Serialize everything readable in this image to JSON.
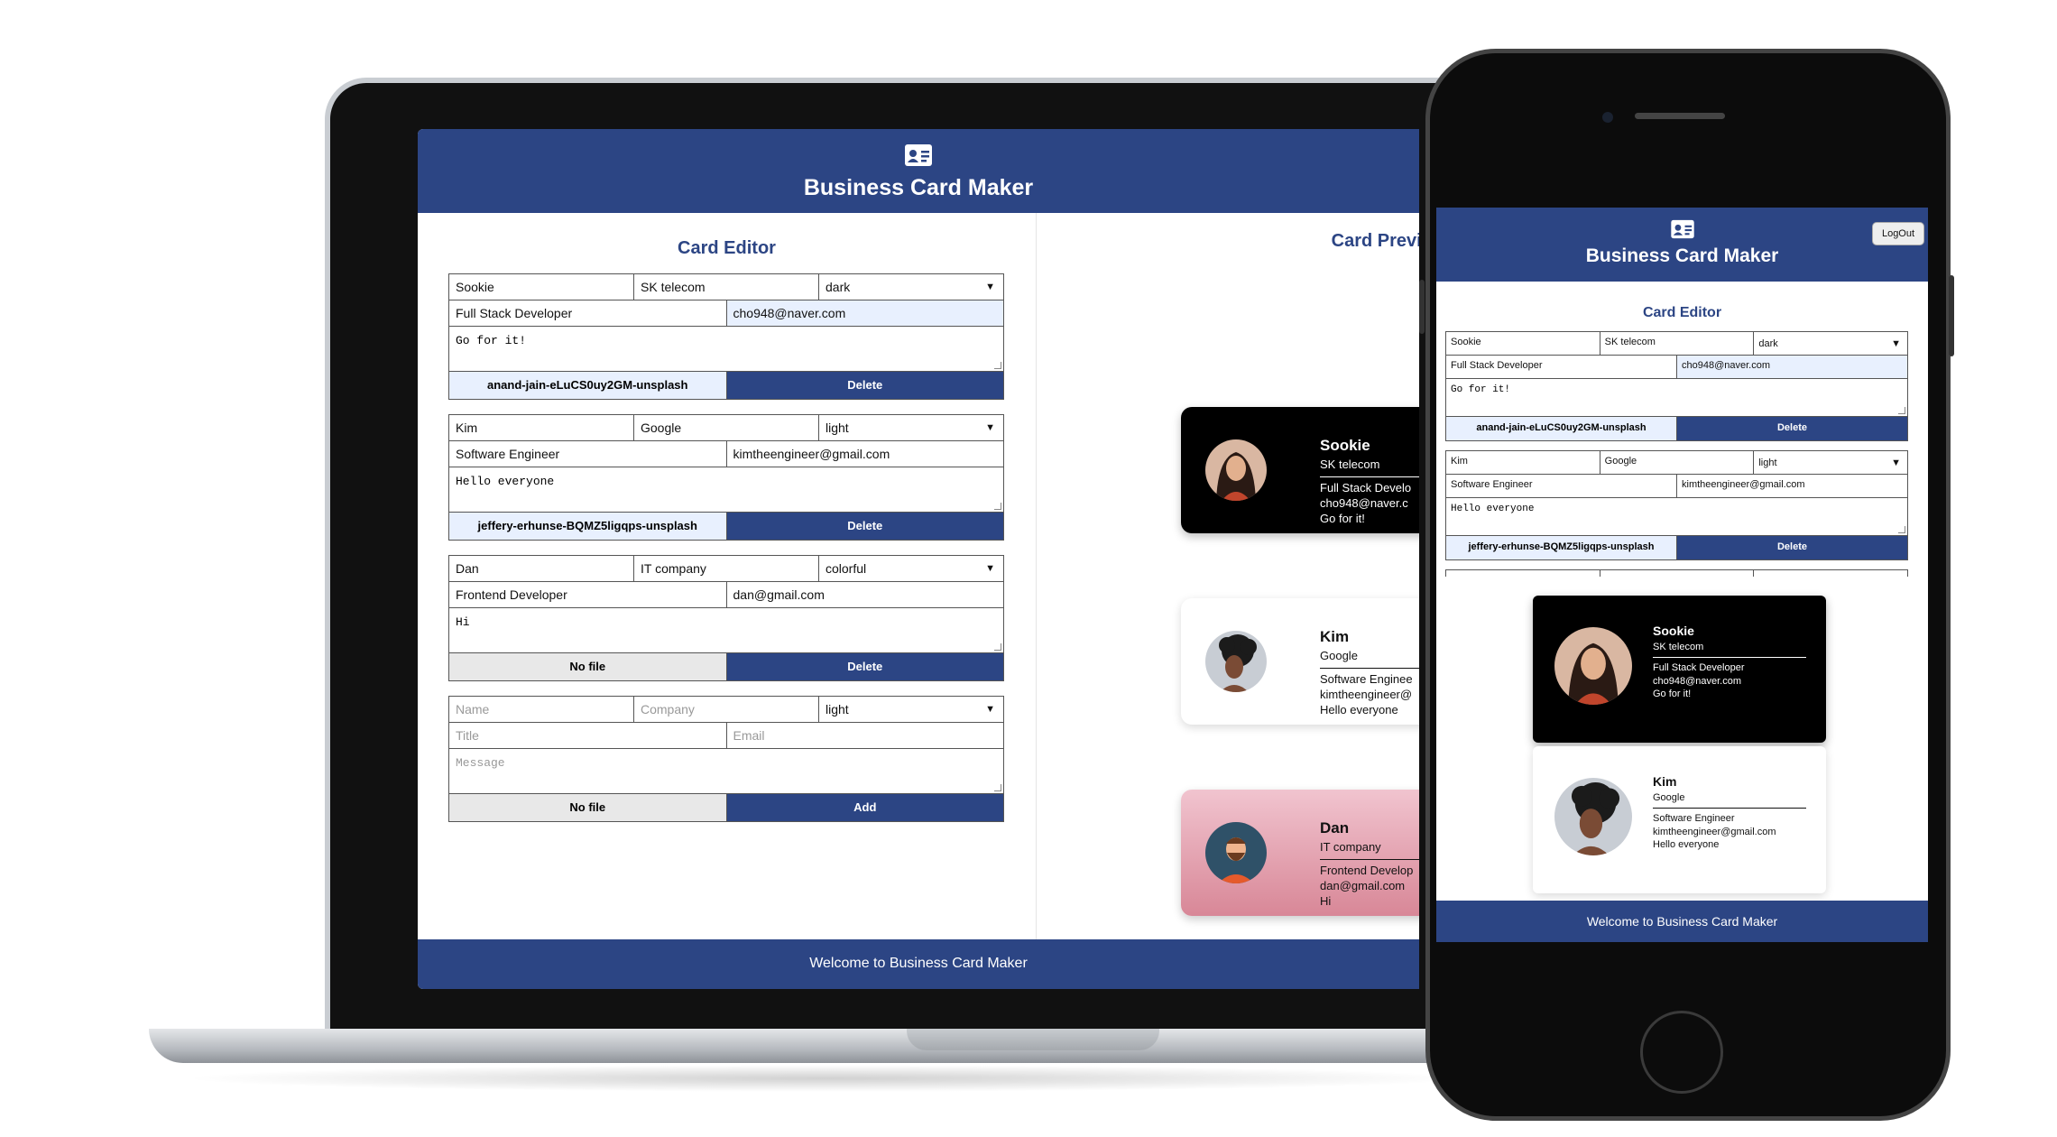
{
  "app": {
    "title": "Business Card Maker",
    "footer": "Welcome to Business Card Maker",
    "logout": "LogOut",
    "brand_color": "#2c4584"
  },
  "editor": {
    "title": "Card Editor",
    "cards": [
      {
        "name": "Sookie",
        "company": "SK telecom",
        "theme": "dark",
        "title": "Full Stack Developer",
        "email": "cho948@naver.com",
        "message": "Go for it!",
        "file": "anand-jain-eLuCS0uy2GM-unsplash",
        "action": "Delete"
      },
      {
        "name": "Kim",
        "company": "Google",
        "theme": "light",
        "title": "Software Engineer",
        "email": "kimtheengineer@gmail.com",
        "message": "Hello everyone",
        "file": "jeffery-erhunse-BQMZ5ligqps-unsplash",
        "action": "Delete"
      },
      {
        "name": "Dan",
        "company": "IT company",
        "theme": "colorful",
        "title": "Frontend Developer",
        "email": "dan@gmail.com",
        "message": "Hi",
        "file": "No file",
        "action": "Delete"
      }
    ],
    "new_card": {
      "name_placeholder": "Name",
      "company_placeholder": "Company",
      "theme": "light",
      "title_placeholder": "Title",
      "email_placeholder": "Email",
      "message_placeholder": "Message",
      "file": "No file",
      "action": "Add"
    }
  },
  "preview": {
    "title": "Card Preview",
    "laptop_cards": [
      {
        "name": "Sookie",
        "company": "SK telecom",
        "title": "Full Stack Develo",
        "email": "cho948@naver.c",
        "message": "Go for it!"
      },
      {
        "name": "Kim",
        "company": "Google",
        "title": "Software Enginee",
        "email": "kimtheengineer@",
        "message": "Hello everyone"
      },
      {
        "name": "Dan",
        "company": "IT company",
        "title": "Frontend Develop",
        "email": "dan@gmail.com",
        "message": "Hi"
      }
    ],
    "phone_cards": [
      {
        "name": "Sookie",
        "company": "SK telecom",
        "title": "Full Stack Developer",
        "email": "cho948@naver.com",
        "message": "Go for it!"
      },
      {
        "name": "Kim",
        "company": "Google",
        "title": "Software Engineer",
        "email": "kimtheengineer@gmail.com",
        "message": "Hello everyone"
      }
    ]
  },
  "icons": {
    "logo": "id-card-icon",
    "dropdown": "chevron-down-icon"
  }
}
